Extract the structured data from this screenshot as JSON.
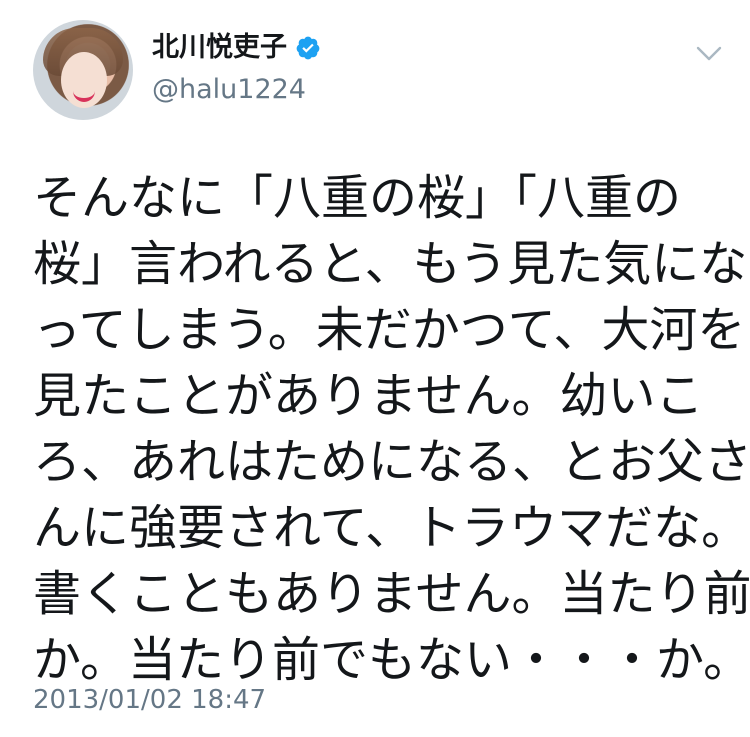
{
  "user": {
    "display_name": "北川悦吏子",
    "handle": "@halu1224",
    "verified": true
  },
  "tweet": {
    "lines": [
      "そんなに「八重の桜」「八重の",
      "桜」言われると、もう見た気にな",
      "ってしまう。未だかつて、大河を",
      "見たことがありません。幼いこ",
      "ろ、あれはためになる、とお父さ",
      "んに強要されて、トラウマだな。",
      "書くこともありません。当たり前",
      "か。当たり前でもない・・・か。"
    ],
    "timestamp": "2013/01/02 18:47"
  },
  "colors": {
    "verified_blue": "#1da1f2",
    "secondary_text": "#657786",
    "primary_text": "#14171a"
  },
  "icons": {
    "verified": "verified-badge-icon",
    "menu": "chevron-down-icon"
  }
}
